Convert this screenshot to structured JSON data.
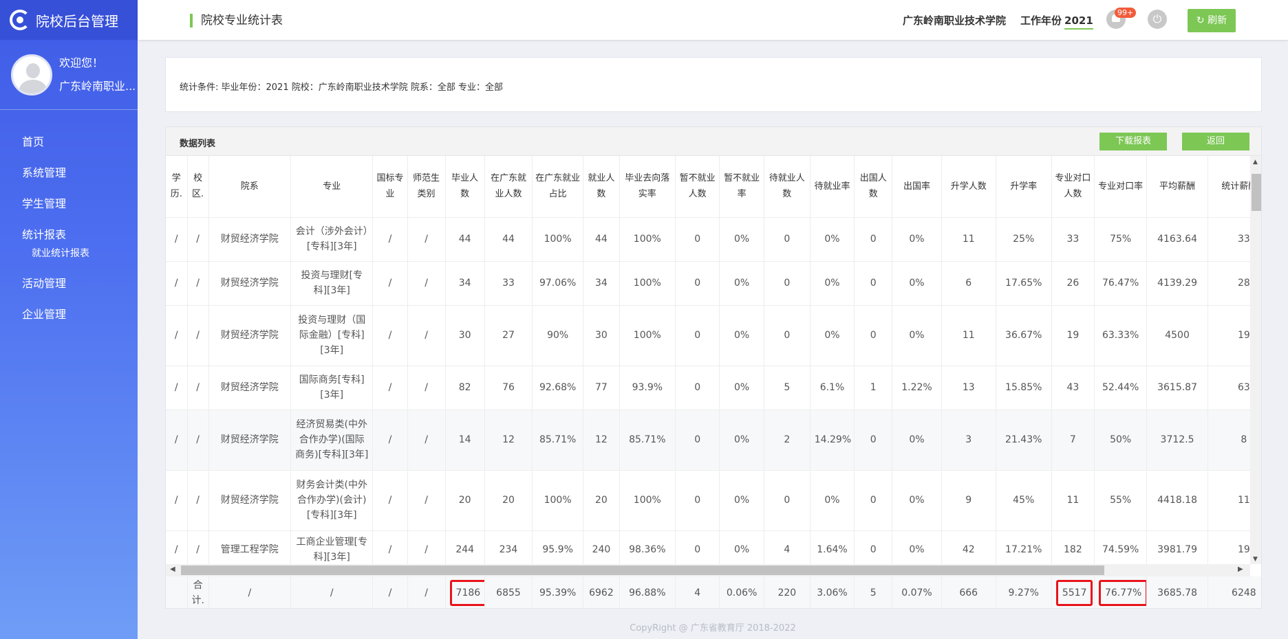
{
  "brand": {
    "title": "院校后台管理"
  },
  "user": {
    "welcome": "欢迎您！",
    "name": "广东岭南职业..."
  },
  "nav": {
    "items": [
      {
        "label": "首页"
      },
      {
        "label": "系统管理"
      },
      {
        "label": "学生管理"
      },
      {
        "label": "统计报表"
      }
    ],
    "sub_label": "就业统计报表",
    "items2": [
      {
        "label": "活动管理"
      },
      {
        "label": "企业管理"
      }
    ]
  },
  "topbar": {
    "page_title": "院校专业统计表",
    "school": "广东岭南职业技术学院",
    "year_label": "工作年份",
    "year_value": "2021",
    "badge": "99+",
    "refresh_label": "刷新"
  },
  "condition": {
    "text": "统计条件:  毕业年份：2021 院校：广东岭南职业技术学院 院系：全部 专业：全部"
  },
  "datalist": {
    "title": "数据列表",
    "download_label": "下载报表",
    "back_label": "返回"
  },
  "table": {
    "headers": [
      "学历.",
      "校区.",
      "院系",
      "专业",
      "国标专业",
      "师范生类别",
      "毕业人数",
      "在广东就业人数",
      "在广东就业占比",
      "就业人数",
      "毕业去向落实率",
      "暂不就业人数",
      "暂不就业率",
      "待就业人数",
      "待就业率",
      "出国人数",
      "出国率",
      "升学人数",
      "升学率",
      "专业对口人数",
      "专业对口率",
      "平均薪酬",
      "统计薪酬人"
    ],
    "rows": [
      [
        "/",
        "/",
        "财贸经济学院",
        "会计（涉外会计）[专科][3年]",
        "/",
        "/",
        "44",
        "44",
        "100%",
        "44",
        "100%",
        "0",
        "0%",
        "0",
        "0%",
        "0",
        "0%",
        "11",
        "25%",
        "33",
        "75%",
        "4163.64",
        "33"
      ],
      [
        "/",
        "/",
        "财贸经济学院",
        "投资与理财[专科][3年]",
        "/",
        "/",
        "34",
        "33",
        "97.06%",
        "34",
        "100%",
        "0",
        "0%",
        "0",
        "0%",
        "0",
        "0%",
        "6",
        "17.65%",
        "26",
        "76.47%",
        "4139.29",
        "28"
      ],
      [
        "/",
        "/",
        "财贸经济学院",
        "投资与理财（国际金融）[专科][3年]",
        "/",
        "/",
        "30",
        "27",
        "90%",
        "30",
        "100%",
        "0",
        "0%",
        "0",
        "0%",
        "0",
        "0%",
        "11",
        "36.67%",
        "19",
        "63.33%",
        "4500",
        "19"
      ],
      [
        "/",
        "/",
        "财贸经济学院",
        "国际商务[专科][3年]",
        "/",
        "/",
        "82",
        "76",
        "92.68%",
        "77",
        "93.9%",
        "0",
        "0%",
        "5",
        "6.1%",
        "1",
        "1.22%",
        "13",
        "15.85%",
        "43",
        "52.44%",
        "3615.87",
        "63"
      ],
      [
        "/",
        "/",
        "财贸经济学院",
        "经济贸易类(中外合作办学)(国际商务)[专科][3年]",
        "/",
        "/",
        "14",
        "12",
        "85.71%",
        "12",
        "85.71%",
        "0",
        "0%",
        "2",
        "14.29%",
        "0",
        "0%",
        "3",
        "21.43%",
        "7",
        "50%",
        "3712.5",
        "8"
      ],
      [
        "/",
        "/",
        "财贸经济学院",
        "财务会计类(中外合作办学)(会计)[专科][3年]",
        "/",
        "/",
        "20",
        "20",
        "100%",
        "20",
        "100%",
        "0",
        "0%",
        "0",
        "0%",
        "0",
        "0%",
        "9",
        "45%",
        "11",
        "55%",
        "4418.18",
        "11"
      ],
      [
        "/",
        "/",
        "管理工程学院",
        "工商企业管理[专科][3年]",
        "/",
        "/",
        "244",
        "234",
        "95.9%",
        "240",
        "98.36%",
        "0",
        "0%",
        "4",
        "1.64%",
        "0",
        "0%",
        "42",
        "17.21%",
        "182",
        "74.59%",
        "3981.79",
        "19"
      ]
    ],
    "total": [
      "",
      "合计.",
      "/",
      "/",
      "/",
      "/",
      "7186",
      "6855",
      "95.39%",
      "6962",
      "96.88%",
      "4",
      "0.06%",
      "220",
      "3.06%",
      "5",
      "0.07%",
      "666",
      "9.27%",
      "5517",
      "76.77%",
      "3685.78",
      "6248"
    ]
  },
  "copyright": "CopyRight @ 广东省教育厅 2018-2022"
}
